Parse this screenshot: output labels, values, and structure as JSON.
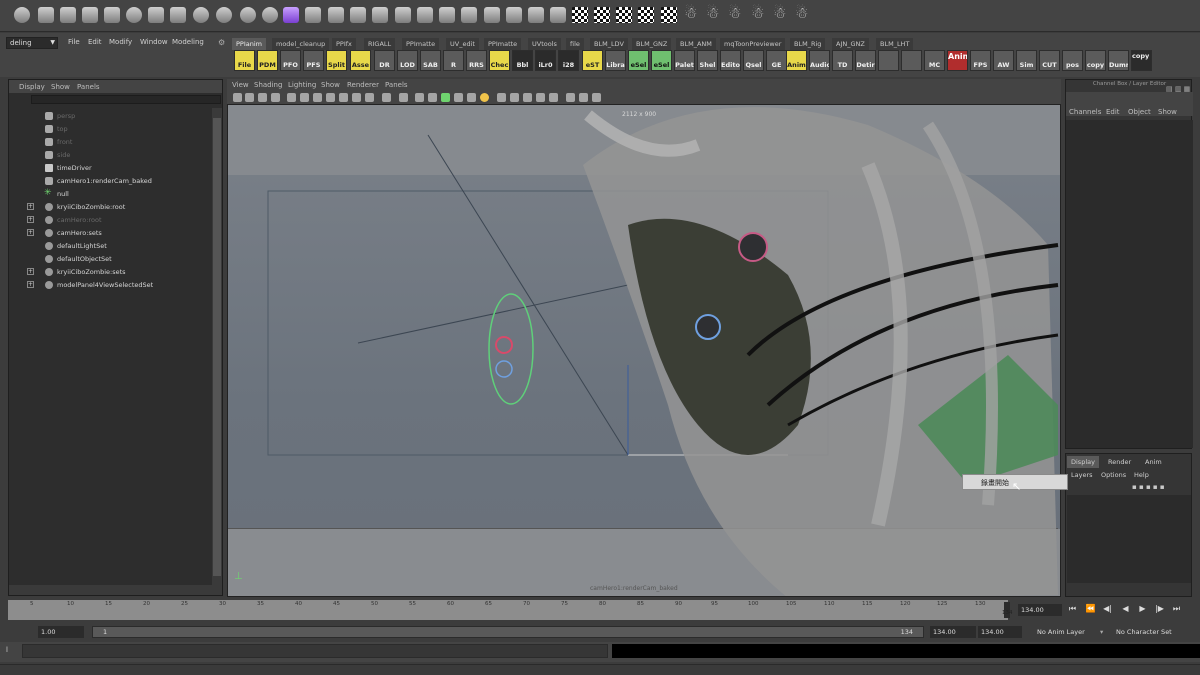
{
  "menubar": {
    "mode_label": "deling",
    "menus": [
      "File",
      "Edit",
      "Modify",
      "Window",
      "Modeling"
    ]
  },
  "shelf_tabs": [
    "PPIanim",
    "model_cleanup",
    "PPIfx",
    "RIGALL",
    "PPImatte",
    "UV_edit",
    "PPImatte",
    "UVtools",
    "file",
    "BLM_LDV",
    "BLM_GNZ",
    "BLM_ANM",
    "mqToonPreviewer",
    "BLM_Rig",
    "AJN_GNZ",
    "BLM_LHT"
  ],
  "shelf_icons": [
    "File",
    "PDM",
    "PFO",
    "PFS",
    "Split",
    "Asse",
    "DR",
    "LOD",
    "SAB",
    "R",
    "RRS",
    "Chec",
    "Bbl",
    "iLr0",
    "i28",
    "eST",
    "Libra",
    "eSel",
    "eSel",
    "Palet",
    "Shel",
    "Edito",
    "Qsel",
    "GE",
    "Anim",
    "Audio",
    "TD",
    "Detir",
    "",
    "",
    "MC",
    "Anim",
    "FPS",
    "AW",
    "Sim",
    "CUT",
    "pos",
    "copy",
    "Dumr",
    "copy Ref"
  ],
  "outliner": {
    "menus": [
      "Display",
      "Show",
      "Panels"
    ],
    "items": [
      {
        "label": "persp",
        "dim": true
      },
      {
        "label": "top",
        "dim": true
      },
      {
        "label": "front",
        "dim": true
      },
      {
        "label": "side",
        "dim": true
      },
      {
        "label": "timeDriver",
        "dim": false
      },
      {
        "label": "camHero1:renderCam_baked",
        "dim": false
      },
      {
        "label": "null",
        "dim": false
      },
      {
        "label": "kryiiCiboZombie:root",
        "dim": false
      },
      {
        "label": "camHero:root",
        "dim": true
      },
      {
        "label": "camHero:sets",
        "dim": false
      },
      {
        "label": "defaultLightSet",
        "dim": false
      },
      {
        "label": "defaultObjectSet",
        "dim": false
      },
      {
        "label": "kryiiCiboZombie:sets",
        "dim": false
      },
      {
        "label": "modelPanel4ViewSelectedSet",
        "dim": false
      }
    ]
  },
  "viewport": {
    "menus": [
      "View",
      "Shading",
      "Lighting",
      "Show",
      "Renderer",
      "Panels"
    ],
    "resolution_label": "2112 x 900",
    "camera_name": "camHero1:renderCam_baked"
  },
  "channel_box": {
    "title": "Channel Box / Layer Editor",
    "menus": [
      "Channels",
      "Edit",
      "Object",
      "Show"
    ]
  },
  "layer_editor": {
    "tabs": [
      "Display",
      "Render",
      "Anim"
    ],
    "menus": [
      "Layers",
      "Options",
      "Help"
    ]
  },
  "timeline": {
    "labels": [
      "5",
      "10",
      "15",
      "20",
      "25",
      "30",
      "35",
      "40",
      "45",
      "50",
      "55",
      "60",
      "65",
      "70",
      "75",
      "80",
      "85",
      "90",
      "95",
      "100",
      "105",
      "110",
      "115",
      "120",
      "125",
      "130"
    ],
    "current_frame": "134.00",
    "current_marker": "134"
  },
  "range": {
    "start_time": "1.00",
    "range_start": "1",
    "range_end": "134",
    "end_time": "134.00",
    "end_time2": "134.00",
    "anim_layer": "No Anim Layer",
    "character_set": "No Character Set"
  },
  "tooltip": "錄畫開始",
  "colors": {
    "ui_bg": "#444444",
    "viewport_top": "#7b8189",
    "shelf_yellow": "#e8d84a",
    "shelf_green": "#6fbf6f",
    "anim_red": "#b12d2d"
  }
}
